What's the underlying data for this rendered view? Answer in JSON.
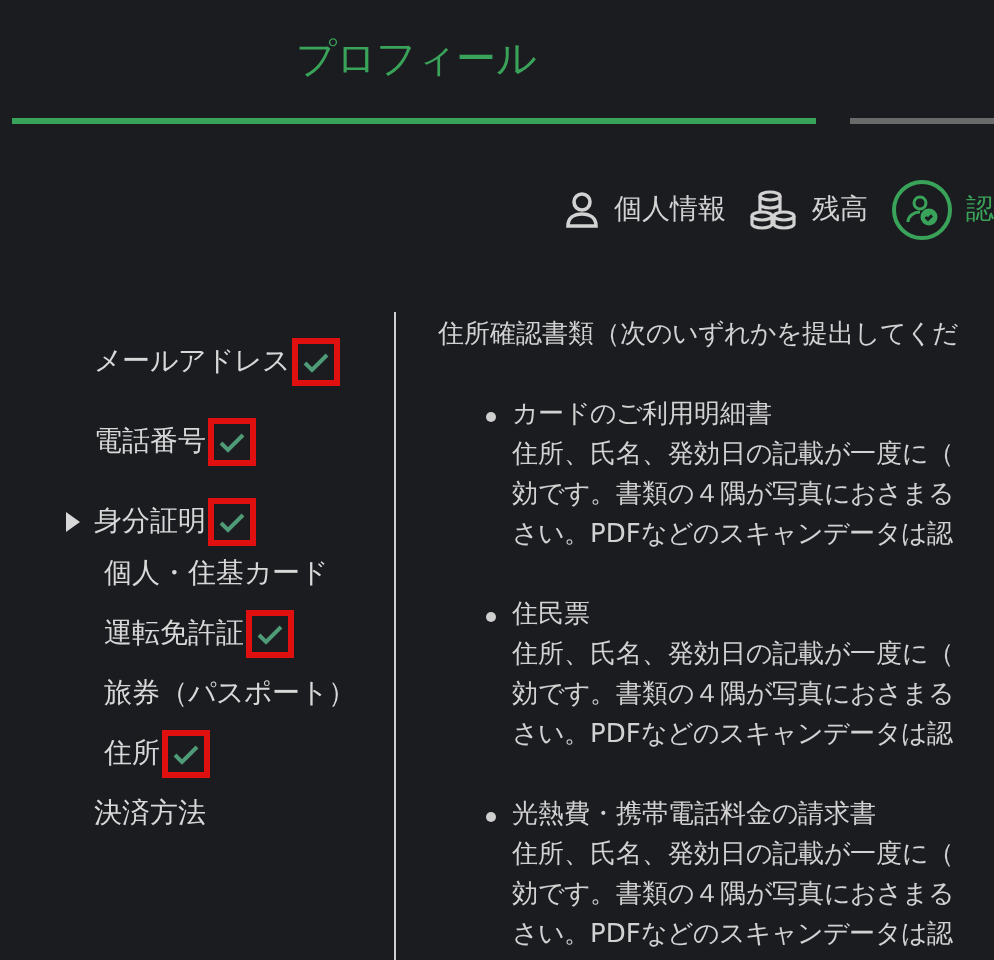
{
  "tabs": [
    {
      "label": "プロフィール",
      "selected": true
    },
    {
      "selected": false
    }
  ],
  "sections": [
    {
      "label": "個人情報",
      "selected": false
    },
    {
      "label": "残高",
      "selected": false
    },
    {
      "label": "認",
      "selected": true
    }
  ],
  "sidebar": {
    "items": [
      {
        "label": "メールアドレス",
        "verified": true
      },
      {
        "label": "電話番号",
        "verified": true
      },
      {
        "label": "身分証明",
        "verified": true,
        "expanded": true,
        "children": [
          {
            "label": "個人・住基カード",
            "verified": false
          },
          {
            "label": "運転免許証",
            "verified": true
          },
          {
            "label": "旅券（パスポート）",
            "verified": false
          },
          {
            "label": "住所",
            "verified": true
          }
        ]
      },
      {
        "label": "決済方法",
        "verified": false
      }
    ]
  },
  "content": {
    "heading": "住所確認書類（次のいずれかを提出してくだ",
    "documents": [
      {
        "title": "カードのご利用明細書",
        "lines": [
          "住所、氏名、発効日の記載が一度に（",
          "効です。書類の４隅が写真におさまる",
          "さい。PDFなどのスキャンデータは認"
        ]
      },
      {
        "title": "住民票",
        "lines": [
          "住所、氏名、発効日の記載が一度に（",
          "効です。書類の４隅が写真におさまる",
          "さい。PDFなどのスキャンデータは認"
        ]
      },
      {
        "title": "光熱費・携帯電話料金の請求書",
        "lines": [
          "住所、氏名、発効日の記載が一度に（",
          "効です。書類の４隅が写真におさまる",
          "さい。PDFなどのスキャンデータは認"
        ]
      }
    ]
  }
}
